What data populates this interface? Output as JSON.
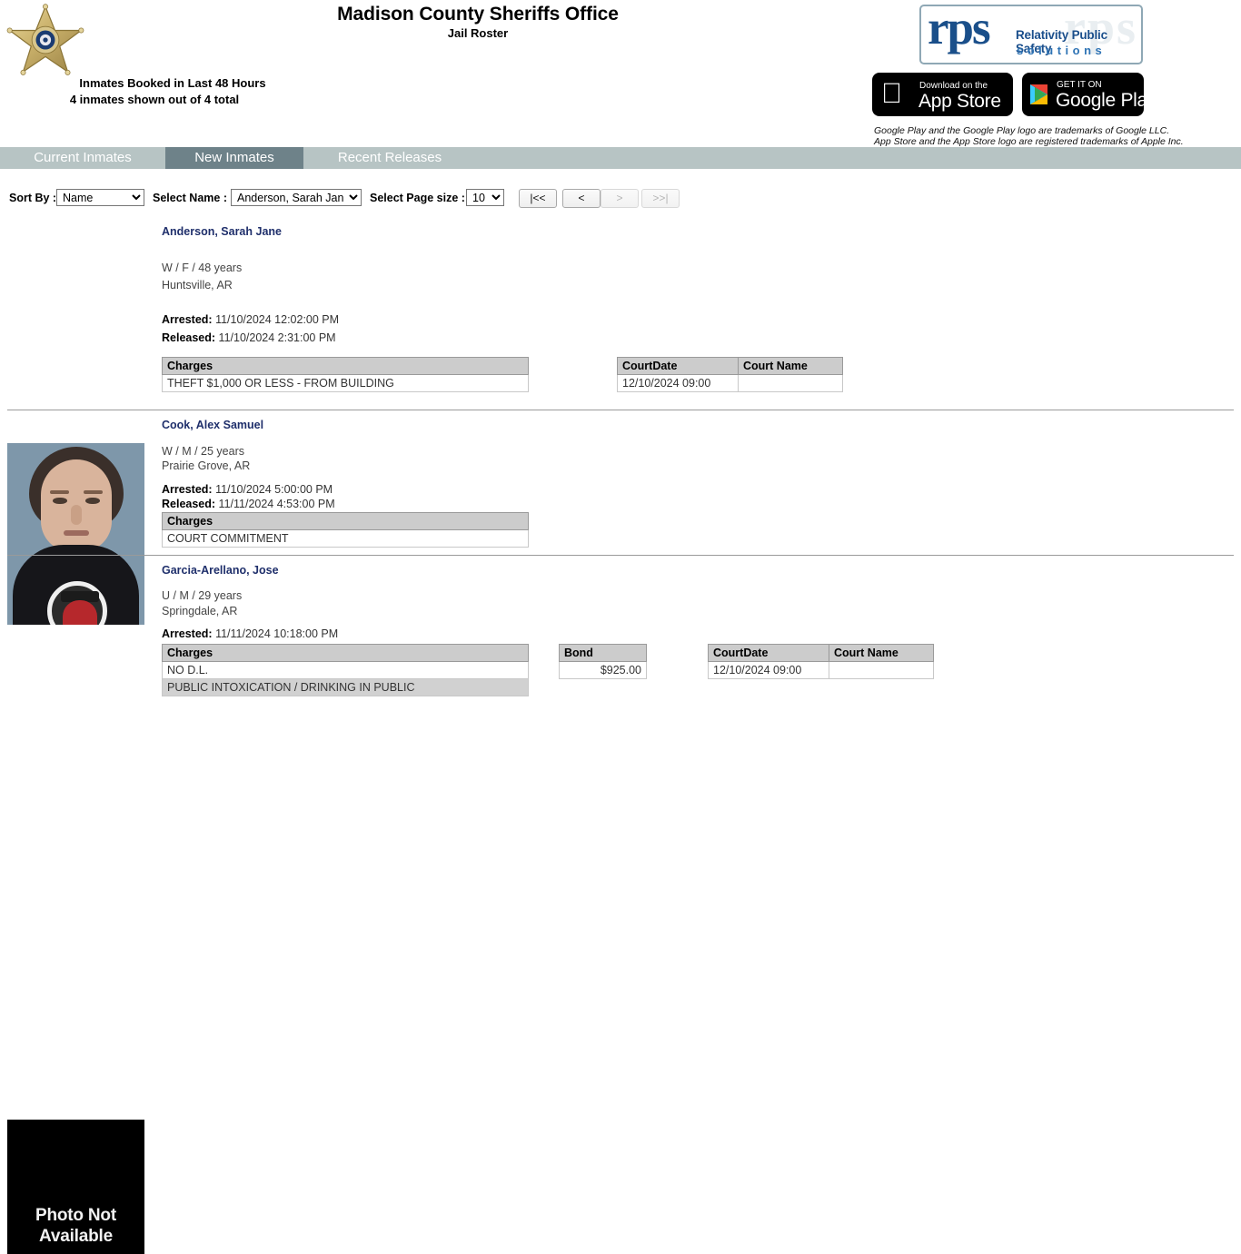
{
  "header": {
    "agency_title": "Madison County Sheriffs Office",
    "page_subtitle": "Jail Roster",
    "booked_heading": "Inmates Booked in Last 48 Hours",
    "count_text": "4 inmates shown out of 4 total",
    "badge_icon": "sheriff-star-badge-icon"
  },
  "branding": {
    "rps_mark": "rps",
    "rps_ghost": "rps",
    "rps_tagline_1": "Relativity Public Safety",
    "rps_tagline_2": "solutions",
    "appstore": {
      "small": "Download on the",
      "big": "App Store",
      "icon": "apple-icon"
    },
    "googleplay": {
      "small": "GET IT ON",
      "big": "Google Play",
      "icon": "google-play-icon"
    },
    "legal_line_1": "Google Play and the Google Play logo are trademarks of Google LLC.",
    "legal_line_2": "App Store and the App Store logo are registered trademarks of Apple Inc.",
    "accent_blue": "#1b4f8c",
    "accent_light_blue": "#2f74b5"
  },
  "tabs": [
    {
      "label": "Current Inmates",
      "active": false
    },
    {
      "label": "New Inmates",
      "active": true
    },
    {
      "label": "Recent Releases",
      "active": false
    }
  ],
  "tabbar_color": "#b7c4c4",
  "active_tab_color": "#6e8289",
  "controls": {
    "sort_by_label": "Sort By :",
    "sort_by_value": "Name",
    "sort_by_options": [
      "Name"
    ],
    "select_name_label": "Select Name :",
    "select_name_value": "Anderson, Sarah Jane",
    "select_name_options": [
      "Anderson, Sarah Jane"
    ],
    "page_size_label": "Select Page size :",
    "page_size_value": "10",
    "page_size_options": [
      "10"
    ],
    "pager": {
      "first": "|<<",
      "prev": "<",
      "next": ">",
      "last": ">>|",
      "first_enabled": true,
      "prev_enabled": true,
      "next_enabled": false,
      "last_enabled": false
    }
  },
  "records": [
    {
      "name": "Anderson, Sarah Jane",
      "demographics": "W / F / 48 years",
      "city": "Huntsville, AR",
      "arrested_label": "Arrested:",
      "arrested_value": "11/10/2024 12:02:00 PM",
      "released_label": "Released:",
      "released_value": "11/10/2024 2:31:00 PM",
      "photo": "mugshot",
      "charges_header": "Charges",
      "charges": [
        "THEFT $1,000 OR LESS - FROM BUILDING"
      ],
      "bond": null,
      "court": {
        "date_header": "CourtDate",
        "name_header": "Court Name",
        "rows": [
          {
            "date": "12/10/2024 09:00",
            "name": ""
          }
        ]
      }
    },
    {
      "name": "Cook, Alex Samuel",
      "demographics": "W / M / 25 years",
      "city": "Prairie Grove, AR",
      "arrested_label": "Arrested:",
      "arrested_value": "11/10/2024 5:00:00 PM",
      "released_label": "Released:",
      "released_value": "11/11/2024 4:53:00 PM",
      "photo": "none",
      "charges_header": "Charges",
      "charges": [
        "COURT COMMITMENT"
      ],
      "bond": null,
      "court": null
    },
    {
      "name": "Garcia-Arellano, Jose",
      "demographics": "U / M / 29 years",
      "city": "Springdale, AR",
      "arrested_label": "Arrested:",
      "arrested_value": "11/11/2024 10:18:00 PM",
      "released_label": null,
      "released_value": null,
      "photo": "placeholder",
      "photo_placeholder_line1": "Photo Not",
      "photo_placeholder_line2": "Available",
      "charges_header": "Charges",
      "charges": [
        "NO D.L.",
        "PUBLIC INTOXICATION / DRINKING IN PUBLIC"
      ],
      "bond": {
        "header": "Bond",
        "rows": [
          "$925.00"
        ]
      },
      "court": {
        "date_header": "CourtDate",
        "name_header": "Court Name",
        "rows": [
          {
            "date": "12/10/2024 09:00",
            "name": ""
          }
        ]
      }
    }
  ]
}
